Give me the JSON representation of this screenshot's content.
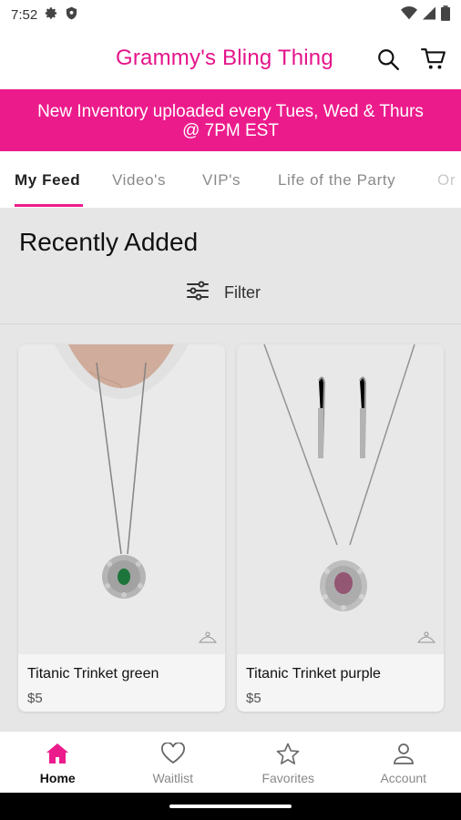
{
  "status_bar": {
    "time": "7:52"
  },
  "header": {
    "title": "Grammy's Bling Thing"
  },
  "banner": {
    "line1": "New Inventory uploaded every Tues, Wed & Thurs",
    "line2": "@ 7PM EST"
  },
  "tabs": [
    {
      "label": "My Feed",
      "active": true
    },
    {
      "label": "Video's"
    },
    {
      "label": "VIP's"
    },
    {
      "label": "Life of the Party"
    },
    {
      "label": "Or"
    }
  ],
  "section": {
    "title": "Recently Added",
    "filter_label": "Filter"
  },
  "products": [
    {
      "name": "Titanic Trinket green",
      "price": "$5",
      "stone_color": "#1f7a3e"
    },
    {
      "name": "Titanic Trinket purple",
      "price": "$5",
      "stone_color": "#9a5a78"
    }
  ],
  "bottom_nav": {
    "home": "Home",
    "waitlist": "Waitlist",
    "favorites": "Favorites",
    "account": "Account"
  },
  "colors": {
    "brand_pink": "#ec1b8c",
    "title_pink": "#e5148a"
  }
}
